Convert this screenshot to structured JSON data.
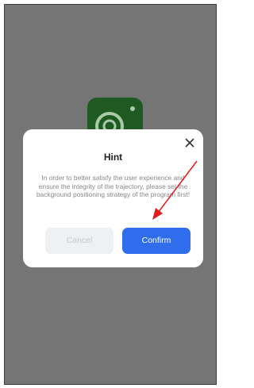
{
  "dialog": {
    "title": "Hint",
    "message": "In order to better satisfy the user experience and ensure the integrity of the trajectory, please set the background positioning strategy of the program first!",
    "cancel_label": "Cancel",
    "confirm_label": "Confirm"
  },
  "colors": {
    "overlay": "#757575",
    "confirm_button": "#2f6ded",
    "annotation_arrow": "#e21b1b",
    "app_icon": "#1f5a23"
  },
  "icons": {
    "app": "location-pin-icon",
    "close": "close-icon",
    "annotation": "red-arrow-icon"
  }
}
